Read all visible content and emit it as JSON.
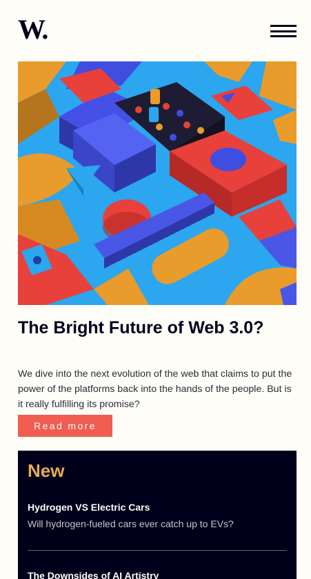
{
  "header": {
    "logo": "W.",
    "menu_icon": "hamburger-menu-icon"
  },
  "hero": {
    "image_subject": "colorful 3D geometric blocks"
  },
  "article": {
    "title": "The Bright Future of Web 3.0?",
    "description": "We dive into the next evolution of the web that claims to put the power of the platforms back into the hands of the people. But is it really fulfilling its promise?",
    "read_more_label": "Read more"
  },
  "new_section": {
    "heading": "New",
    "items": [
      {
        "title": "Hydrogen VS Electric Cars",
        "subtitle": "Will hydrogen-fueled cars ever catch up to EVs?"
      },
      {
        "title": "The Downsides of AI Artistry",
        "subtitle": ""
      }
    ]
  },
  "colors": {
    "background": "#fffdf8",
    "text": "#00001a",
    "accent_red": "#f15d51",
    "accent_orange": "#e9ab53",
    "panel": "#00001a"
  }
}
